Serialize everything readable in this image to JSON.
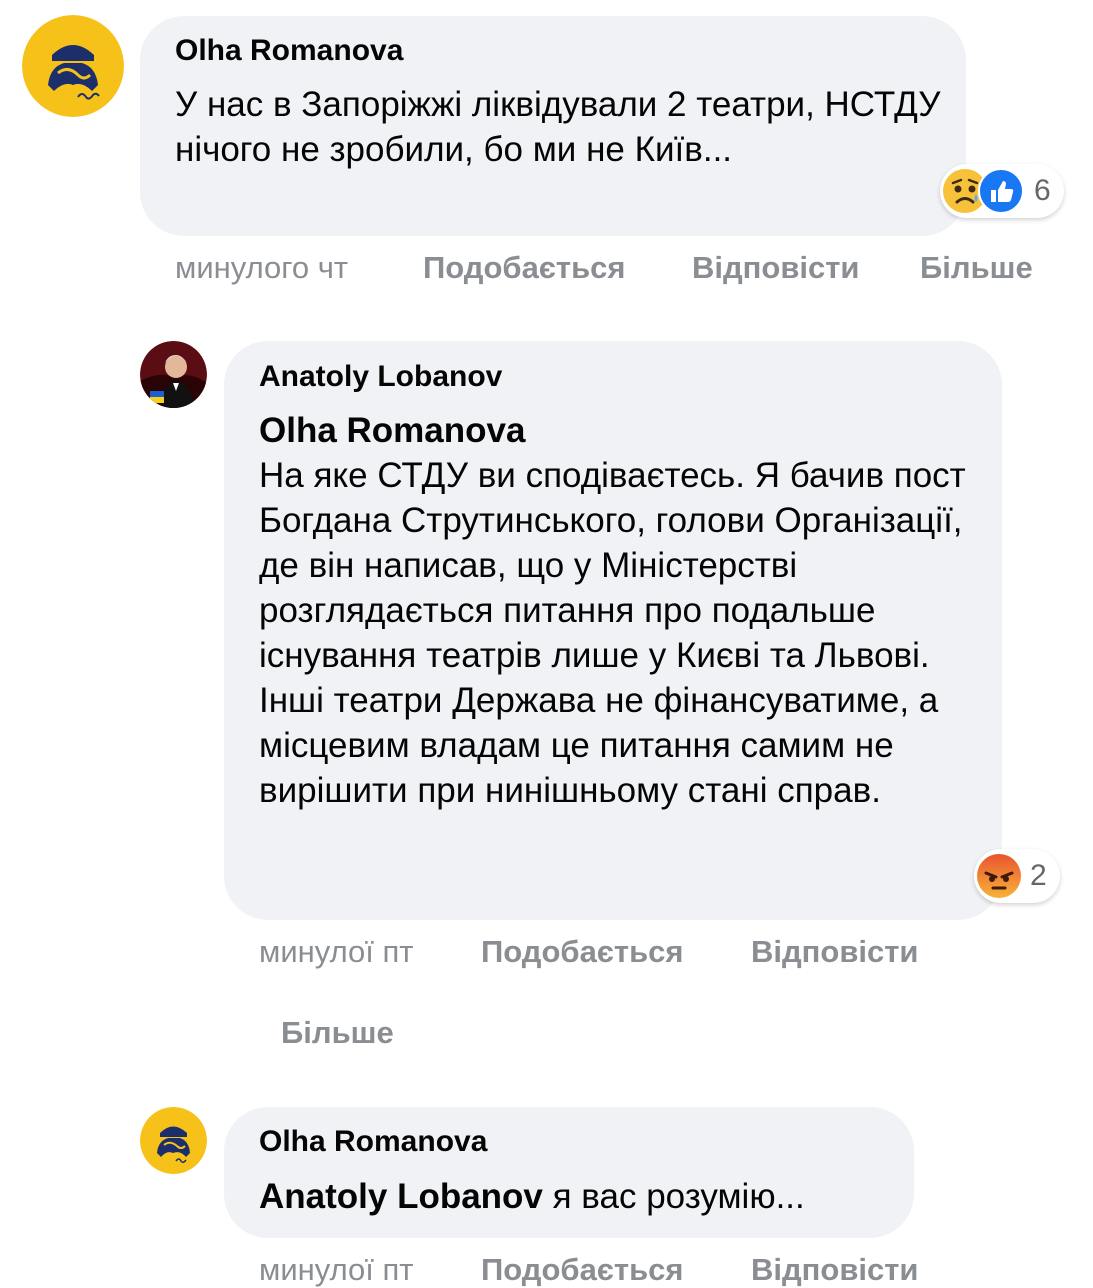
{
  "comments": [
    {
      "author": "Olha Romanova",
      "text": "У нас в Запоріжжі ліквідували 2 театри, НСТДУ нічого не зробили, бо ми не Київ...",
      "reactions": {
        "icons": [
          "sad-reaction-icon",
          "like-reaction-icon"
        ],
        "count": "6"
      },
      "time": "минулого чт",
      "like_label": "Подобається",
      "reply_label": "Відповісти",
      "more_label": "Більше"
    },
    {
      "author": "Anatoly Lobanov",
      "mention": "Olha Romanova",
      "text": "На яке СТДУ ви сподіваєтесь. Я бачив пост Богдана Струтинського, голови Організації, де він написав, що у Міністерстві розглядається питання про подальше існування театрів лише у Києві та Львові. Інші театри Держава не фінансуватиме, а місцевим владам це питання самим не вирішити при нинішньому стані справ.",
      "reactions": {
        "icons": [
          "angry-reaction-icon"
        ],
        "count": "2"
      },
      "time": "минулої пт",
      "like_label": "Подобається",
      "reply_label": "Відповісти",
      "more_label": "Більше"
    },
    {
      "author": "Olha Romanova",
      "mention": "Anatoly Lobanov",
      "text": " я вас розумію...",
      "time": "минулої пт",
      "like_label": "Подобається",
      "reply_label": "Відповісти"
    }
  ],
  "colors": {
    "bubble": "#f0f2f5",
    "meta_text": "#8a8d91",
    "like_blue": "#1877f2",
    "avatar_yellow": "#f6c21a",
    "avatar_navy": "#1c2f6b"
  }
}
